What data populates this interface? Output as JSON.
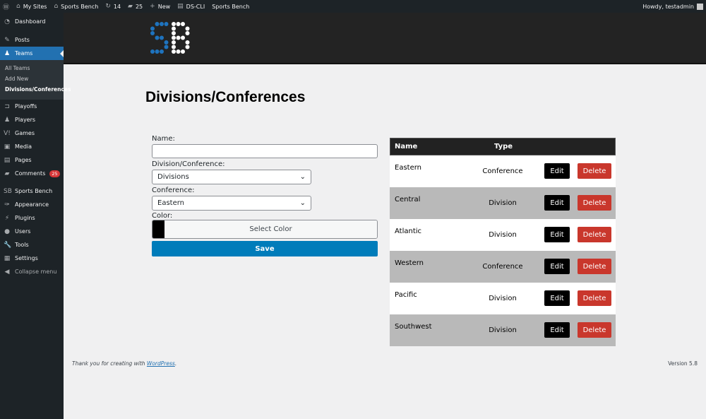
{
  "adminbar": {
    "my_sites": "My Sites",
    "site": "Sports Bench",
    "updates": "14",
    "comments": "25",
    "new": "New",
    "dscli": "DS-CLI",
    "site2": "Sports Bench",
    "howdy": "Howdy, testadmin"
  },
  "sidebar": {
    "items": [
      {
        "label": "Dashboard",
        "icon": "dashboard-icon"
      },
      {
        "label": "Posts",
        "icon": "pin-icon"
      },
      {
        "label": "Teams",
        "icon": "groups-icon"
      },
      {
        "label": "Playoffs",
        "icon": "bracket-icon"
      },
      {
        "label": "Players",
        "icon": "groups-icon"
      },
      {
        "label": "Games",
        "icon": "versus-icon"
      },
      {
        "label": "Media",
        "icon": "media-icon"
      },
      {
        "label": "Pages",
        "icon": "pages-icon"
      },
      {
        "label": "Comments",
        "icon": "comment-icon",
        "badge": "25"
      },
      {
        "label": "Sports Bench",
        "icon": "sb-icon"
      },
      {
        "label": "Appearance",
        "icon": "brush-icon"
      },
      {
        "label": "Plugins",
        "icon": "plugin-icon"
      },
      {
        "label": "Users",
        "icon": "user-icon"
      },
      {
        "label": "Tools",
        "icon": "wrench-icon"
      },
      {
        "label": "Settings",
        "icon": "settings-icon"
      }
    ],
    "submenu": [
      "All Teams",
      "Add New",
      "Divisions/Conferences"
    ],
    "collapse": "Collapse menu"
  },
  "page": {
    "title": "Divisions/Conferences"
  },
  "form": {
    "name_label": "Name:",
    "name_value": "",
    "type_label": "Division/Conference:",
    "type_value": "Divisions",
    "conf_label": "Conference:",
    "conf_value": "Eastern",
    "color_label": "Color:",
    "color_value": "#000000",
    "select_color": "Select Color",
    "save": "Save"
  },
  "table": {
    "headers": [
      "Name",
      "Type"
    ],
    "edit": "Edit",
    "delete": "Delete",
    "rows": [
      {
        "name": "Eastern",
        "type": "Conference"
      },
      {
        "name": "Central",
        "type": "Division"
      },
      {
        "name": "Atlantic",
        "type": "Division"
      },
      {
        "name": "Western",
        "type": "Conference"
      },
      {
        "name": "Pacific",
        "type": "Division"
      },
      {
        "name": "Southwest",
        "type": "Division"
      }
    ]
  },
  "footer": {
    "text": "Thank you for creating with ",
    "link": "WordPress",
    "end": ".",
    "version": "Version 5.8"
  },
  "colors": {
    "accent": "#2271b1",
    "save": "#007cba",
    "delete": "#c9372c",
    "logo_blue": "#1e73be"
  }
}
